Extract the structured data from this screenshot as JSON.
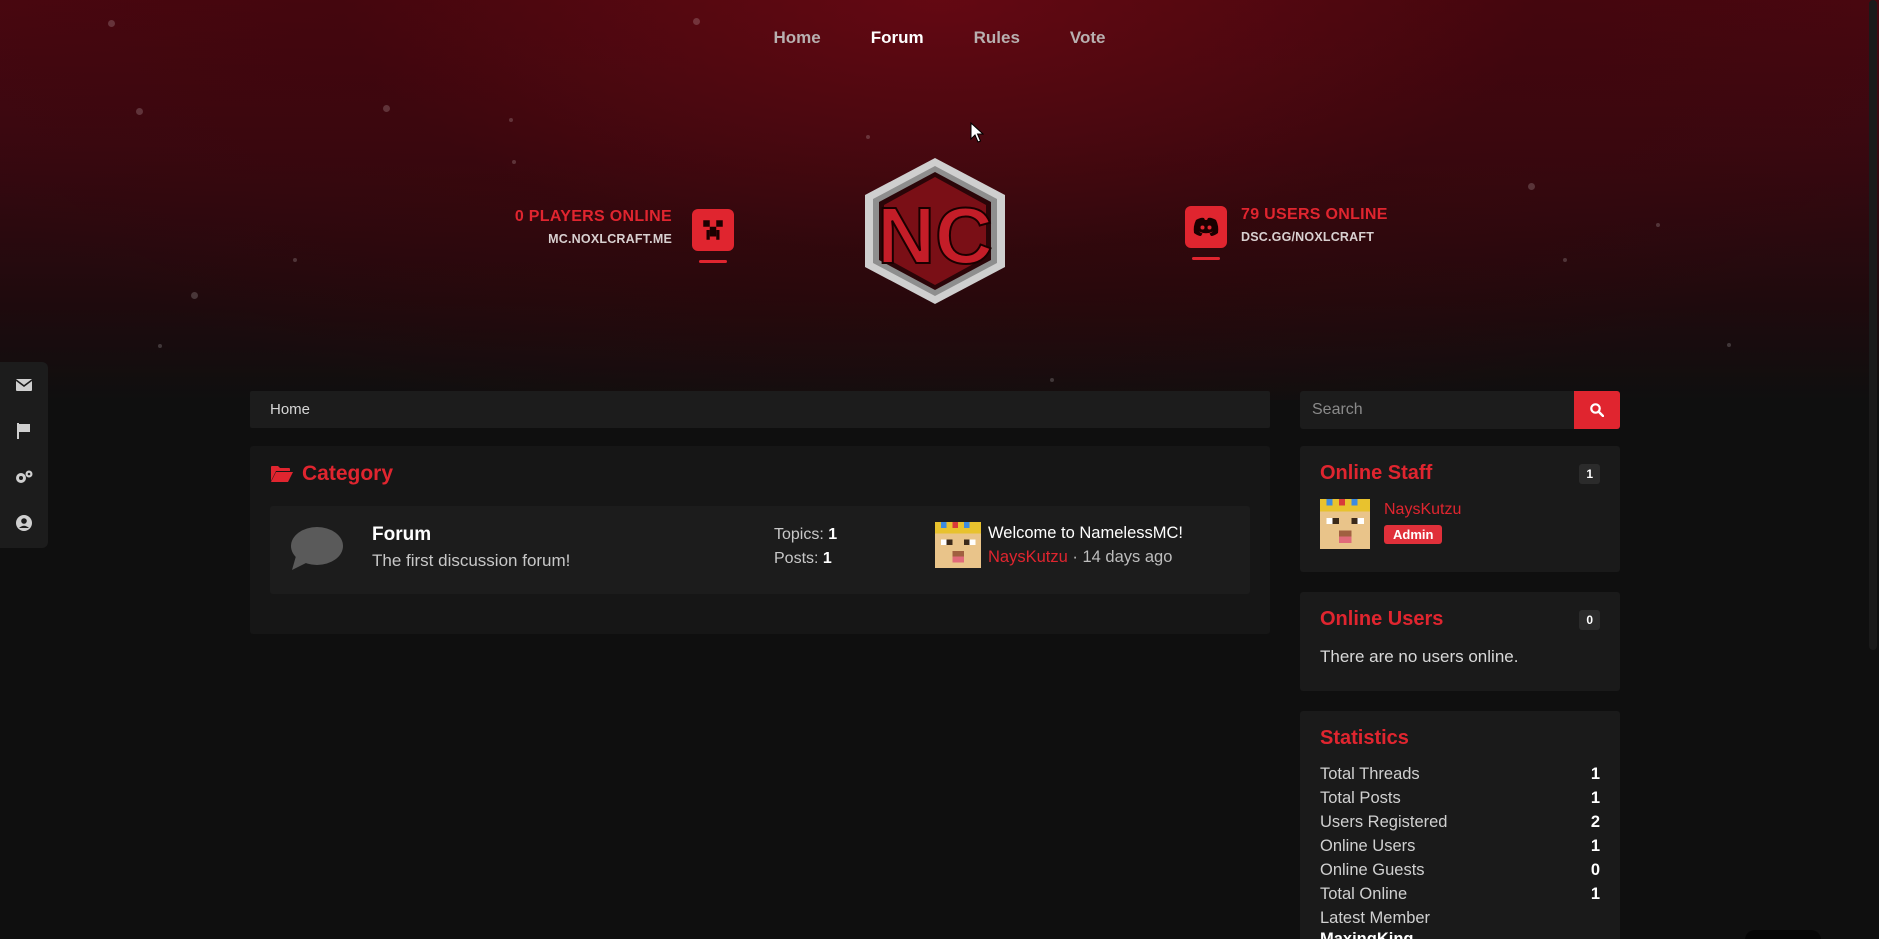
{
  "nav": {
    "items": [
      {
        "label": "Home",
        "active": false
      },
      {
        "label": "Forum",
        "active": true
      },
      {
        "label": "Rules",
        "active": false
      },
      {
        "label": "Vote",
        "active": false
      }
    ]
  },
  "minecraft": {
    "title": "0 PLAYERS ONLINE",
    "address": "MC.NOXLCRAFT.ME",
    "icon": "creeper-icon"
  },
  "discord": {
    "title": "79 USERS ONLINE",
    "invite": "DSC.GG/NOXLCRAFT",
    "icon": "discord-icon"
  },
  "logo": {
    "text": "NC"
  },
  "dock": {
    "icons": [
      "envelope-icon",
      "flag-icon",
      "cogs-icon",
      "user-circle-icon"
    ]
  },
  "breadcrumb": {
    "home": "Home"
  },
  "category": {
    "title": "Category",
    "icon": "folder-open-icon",
    "forums": [
      {
        "name": "Forum",
        "description": "The first discussion forum!",
        "topics_label": "Topics:",
        "topics": "1",
        "posts_label": "Posts:",
        "posts": "1",
        "latest_title": "Welcome to NamelessMC!",
        "latest_user": "NaysKutzu",
        "latest_time": "· 14 days ago"
      }
    ]
  },
  "search": {
    "placeholder": "Search"
  },
  "online_staff": {
    "title": "Online Staff",
    "count": "1",
    "members": [
      {
        "name": "NaysKutzu",
        "role": "Admin"
      }
    ]
  },
  "online_users": {
    "title": "Online Users",
    "count": "0",
    "empty": "There are no users online."
  },
  "statistics": {
    "title": "Statistics",
    "rows": [
      {
        "label": "Total Threads",
        "value": "1"
      },
      {
        "label": "Total Posts",
        "value": "1"
      },
      {
        "label": "Users Registered",
        "value": "2"
      },
      {
        "label": "Online Users",
        "value": "1"
      },
      {
        "label": "Online Guests",
        "value": "0"
      },
      {
        "label": "Total Online",
        "value": "1"
      }
    ],
    "latest_member_label": "Latest Member",
    "latest_member": "MaxingKing"
  },
  "colors": {
    "accent": "#e0252f",
    "background": "#0f0f0f",
    "panel": "#1c1c1c",
    "hero": "#4a0710"
  }
}
